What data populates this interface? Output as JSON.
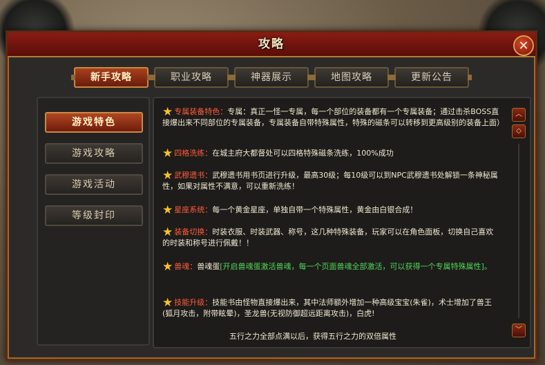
{
  "window": {
    "title": "攻略",
    "close_label": "✕"
  },
  "tabs": [
    {
      "label": "新手攻略",
      "active": true
    },
    {
      "label": "职业攻略",
      "active": false
    },
    {
      "label": "神器展示",
      "active": false
    },
    {
      "label": "地图攻略",
      "active": false
    },
    {
      "label": "更新公告",
      "active": false
    }
  ],
  "sidebar": [
    {
      "label": "游戏特色",
      "active": true
    },
    {
      "label": "游戏攻略",
      "active": false
    },
    {
      "label": "游戏活动",
      "active": false
    },
    {
      "label": "等级封印",
      "active": false
    }
  ],
  "entries": [
    {
      "key": "专属装备特色：",
      "text": "专属：真正一怪一专属，每一个部位的装备都有一个专属装备；通过击杀BOSS直接爆出来不同部位的专属装备，专属装备自带特殊属性，特殊的磁条可以转移到更高级别的装备上面）"
    },
    {
      "key": "四格洗练：",
      "text": "在城主府大都督处可以四格特殊磁条洗练，100%成功"
    },
    {
      "key": "武穆遗书：",
      "text": "武穆遗书用书页进行升级，最高30级；每10级可以到NPC武穆遗书处解锁一条神秘属性，如果对属性不满意，可以重新洗练！"
    },
    {
      "key": "星座系统：",
      "text": "每一个黄金星座，单独自带一个特殊属性，黄金由白银合成！"
    },
    {
      "key": "装备切换：",
      "text": "时装衣服、时装武器、称号，这几种特殊装备，玩家可以在角色面板，切换自己喜欢的时装和称号进行佩戴！！"
    },
    {
      "key": "兽魂：",
      "text": "兽魂蛋",
      "green": "[开启兽魂蛋激活兽魂，每一个页面兽魂全部激活，可以获得一个专属特殊属性]。"
    },
    {
      "key": "技能升级：",
      "text": "技能书由怪物直接爆出来，其中法师额外增加一种高级宝宝(朱雀)，术士增加了兽王(狐月攻击，附带眩晕)，圣龙兽(无视防御超远距离攻击)，白虎!"
    }
  ],
  "footer_text": "五行之力全部点满以后，获得五行之力的双倍属性",
  "scroll": {
    "up_label": "︿",
    "up2_label": "◇",
    "down_label": "﹀"
  }
}
